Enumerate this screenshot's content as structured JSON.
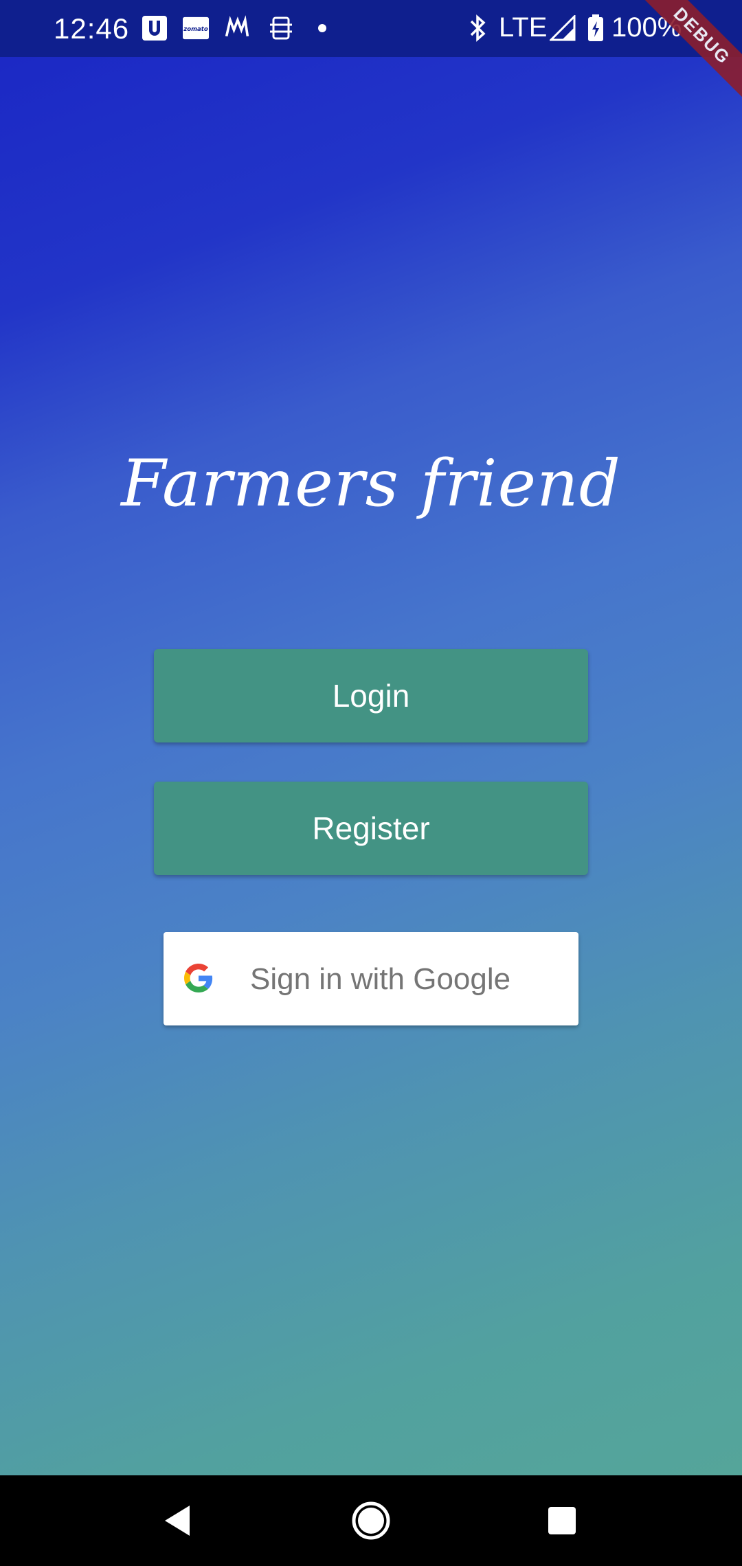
{
  "status_bar": {
    "time": "12:46",
    "notification_icons": [
      "urban-company-icon",
      "zomato-icon",
      "meesho-icon",
      "tech-icon",
      "dot-icon"
    ],
    "network": "LTE",
    "battery": "100%"
  },
  "debug_banner": "DEBUG",
  "app": {
    "title": "Farmers friend",
    "login_label": "Login",
    "register_label": "Register",
    "google_label": "Sign in with Google"
  },
  "colors": {
    "status_bar": "#0f1f8e",
    "button_green": "#439384",
    "gradient_top": "#1a26c4",
    "gradient_bottom": "#55a59a"
  },
  "nav_bar": {
    "icons": [
      "back-icon",
      "home-icon",
      "recents-icon"
    ]
  }
}
